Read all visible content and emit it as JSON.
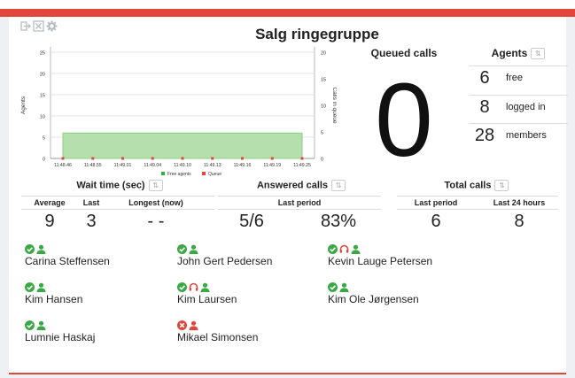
{
  "title": "Salg ringegruppe",
  "colors": {
    "accent": "#e2463b",
    "green": "#3aa845",
    "red": "#e2463b",
    "chart_fill": "#b5dfad"
  },
  "toolbar_icons": [
    "exit-icon",
    "close-box-icon",
    "gear-icon"
  ],
  "chart_data": {
    "type": "area",
    "x": [
      "11:48.46",
      "11:48.55",
      "11:49.01",
      "11:49.04",
      "11:49.10",
      "11:49.13",
      "11:49.16",
      "11:49.19",
      "11:49.25"
    ],
    "series": [
      {
        "name": "Free agents",
        "values": [
          6,
          6,
          6,
          6,
          6,
          6,
          6,
          6,
          6
        ],
        "color": "#3aa845"
      },
      {
        "name": "Queue",
        "values": [
          0,
          0,
          0,
          0,
          0,
          0,
          0,
          0,
          0
        ],
        "color": "#e2463b"
      }
    ],
    "ylabel": "Agents",
    "y2label": "Calls in queue",
    "yticks": [
      "0",
      "5",
      "10",
      "15",
      "20",
      "25"
    ],
    "y2ticks": [
      "0",
      "5",
      "10",
      "15",
      "20"
    ],
    "ylim": [
      0,
      25
    ],
    "y2lim": [
      0,
      20
    ],
    "legend": "bottom"
  },
  "queued": {
    "label": "Queued calls",
    "value": "0"
  },
  "agents": {
    "label": "Agents",
    "sort_icon": "sort-icon",
    "rows": [
      {
        "value": "6",
        "label": "free"
      },
      {
        "value": "8",
        "label": "logged in"
      },
      {
        "value": "28",
        "label": "members"
      }
    ]
  },
  "wait": {
    "label": "Wait time (sec)",
    "cols": [
      "Average",
      "Last",
      "Longest (now)"
    ],
    "values": [
      "9",
      "3",
      "- -"
    ]
  },
  "answered": {
    "label": "Answered calls",
    "sub": "Last period",
    "values": [
      "5/6",
      "83%"
    ]
  },
  "total": {
    "label": "Total calls",
    "cols": [
      "Last period",
      "Last 24 hours"
    ],
    "values": [
      "6",
      "8"
    ]
  },
  "agent_list": [
    {
      "name": "Carina Steffensen",
      "status": "ok",
      "on_call": false
    },
    {
      "name": "John Gert Pedersen",
      "status": "ok",
      "on_call": false
    },
    {
      "name": "Kevin Lauge Petersen",
      "status": "ok",
      "on_call": true
    },
    {
      "name": "Kim Hansen",
      "status": "ok",
      "on_call": false
    },
    {
      "name": "Kim Laursen",
      "status": "ok",
      "on_call": true
    },
    {
      "name": "Kim Ole Jørgensen",
      "status": "ok",
      "on_call": false
    },
    {
      "name": "Lumnie Haskaj",
      "status": "ok",
      "on_call": false
    },
    {
      "name": "Mikael Simonsen",
      "status": "busy",
      "on_call": false
    }
  ]
}
